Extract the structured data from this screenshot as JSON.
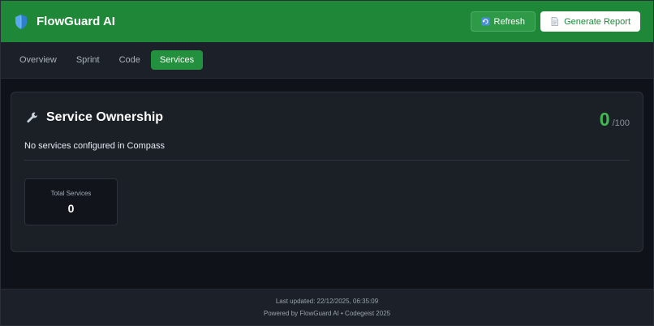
{
  "header": {
    "app_title": "FlowGuard AI",
    "logo_icon": "shield-icon",
    "refresh_label": "Refresh",
    "refresh_icon": "refresh-icon",
    "report_label": "Generate Report",
    "report_icon": "document-icon",
    "brand_color": "#1f8838"
  },
  "tabs": [
    {
      "label": "Overview",
      "active": false
    },
    {
      "label": "Sprint",
      "active": false
    },
    {
      "label": "Code",
      "active": false
    },
    {
      "label": "Services",
      "active": true
    }
  ],
  "card": {
    "icon": "wrench-icon",
    "title": "Service Ownership",
    "score": "0",
    "score_max": "/100",
    "message": "No services configured in Compass",
    "stat": {
      "label": "Total Services",
      "value": "0"
    }
  },
  "footer": {
    "last_updated": "Last updated: 22/12/2025, 06:35:09",
    "powered_by": "Powered by FlowGuard AI • Codegeist 2025"
  }
}
